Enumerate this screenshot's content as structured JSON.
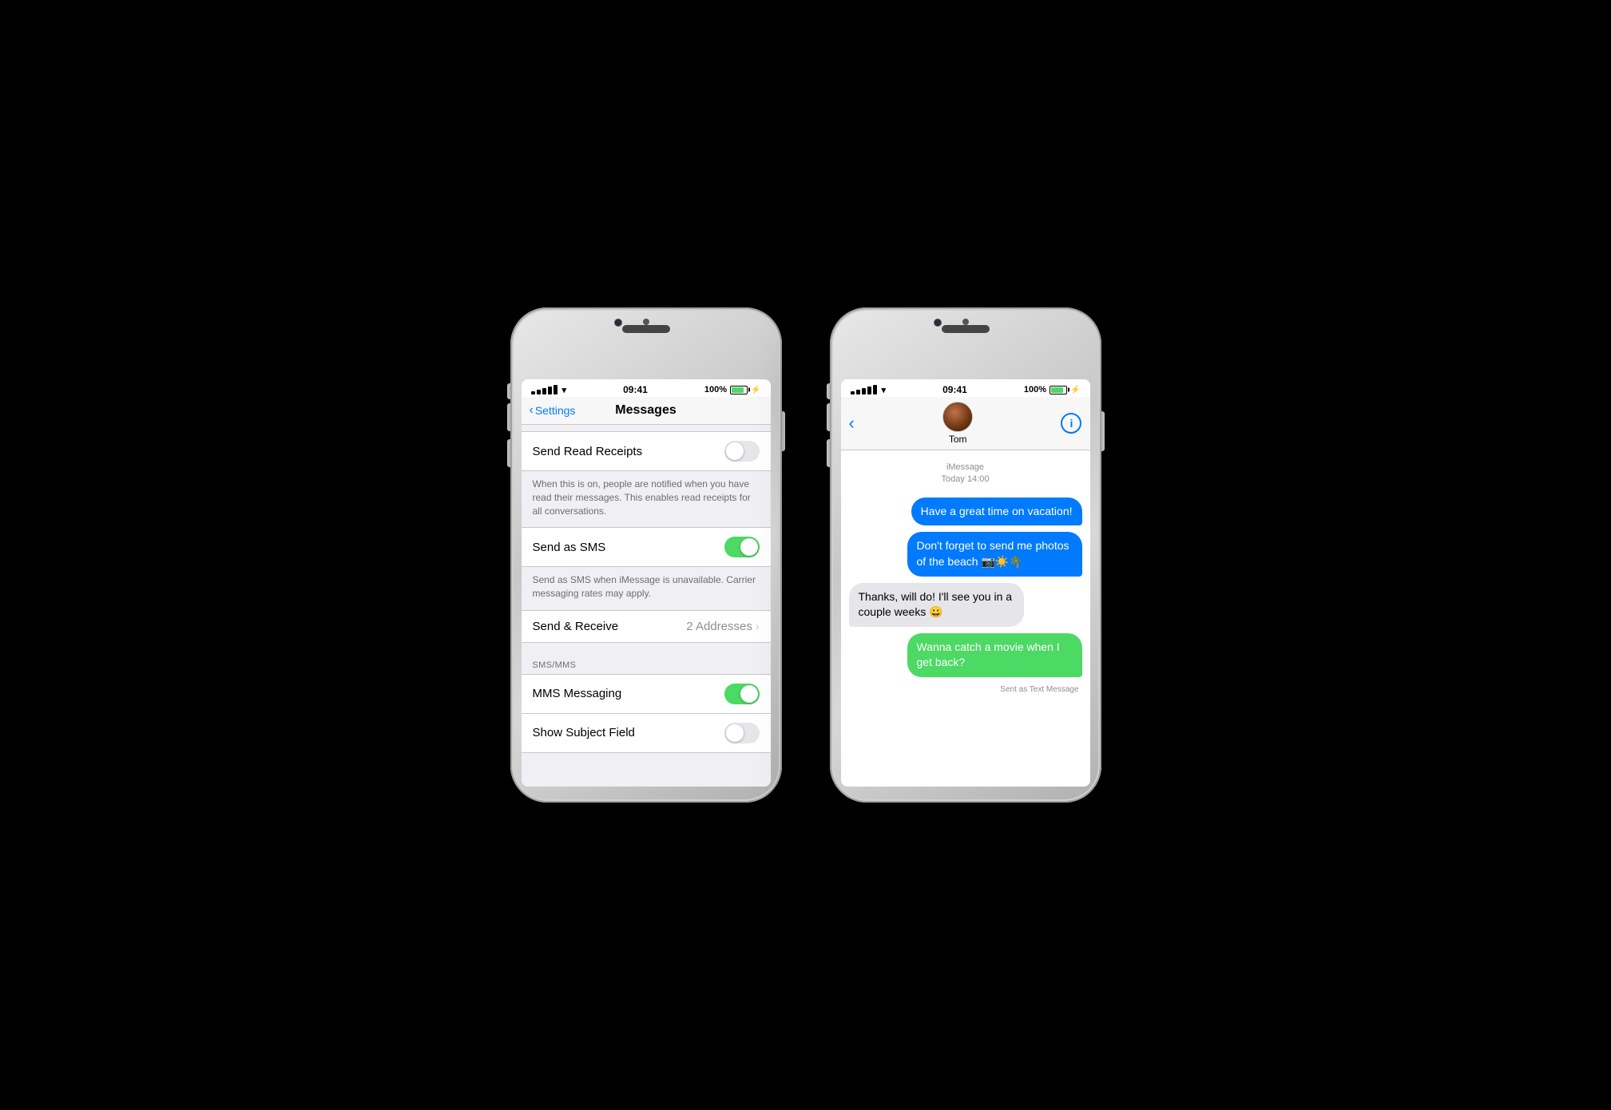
{
  "scene": {
    "background": "#000"
  },
  "phone1": {
    "statusBar": {
      "time": "09:41",
      "batteryPercent": "100%",
      "signal": "●●●●●",
      "wifi": "wifi"
    },
    "navBar": {
      "backLabel": "Settings",
      "title": "Messages"
    },
    "settings": {
      "rows": [
        {
          "label": "Send Read Receipts",
          "toggle": "off",
          "footer": "When this is on, people are notified when you have read their messages. This enables read receipts for all conversations."
        },
        {
          "label": "Send as SMS",
          "toggle": "on",
          "footer": "Send as SMS when iMessage is unavailable. Carrier messaging rates may apply."
        },
        {
          "label": "Send & Receive",
          "detail": "2 Addresses",
          "hasChevron": true
        }
      ],
      "section": {
        "header": "SMS/MMS",
        "rows": [
          {
            "label": "MMS Messaging",
            "toggle": "on"
          },
          {
            "label": "Show Subject Field",
            "toggle": "off"
          }
        ]
      }
    }
  },
  "phone2": {
    "statusBar": {
      "time": "09:41",
      "batteryPercent": "100%"
    },
    "navBar": {
      "contactName": "Tom",
      "infoButton": "i"
    },
    "messages": {
      "timestampLine1": "iMessage",
      "timestampLine2": "Today 14:00",
      "bubbles": [
        {
          "type": "sent-blue",
          "text": "Have a great time on vacation!"
        },
        {
          "type": "sent-blue",
          "text": "Don't forget to send me photos of the beach 📷☀️🌴"
        },
        {
          "type": "received-gray",
          "text": "Thanks, will do! I'll see you in a couple weeks 😀"
        },
        {
          "type": "sent-green",
          "text": "Wanna catch a movie when I get back?",
          "sentLabel": "Sent as Text Message"
        }
      ]
    }
  }
}
